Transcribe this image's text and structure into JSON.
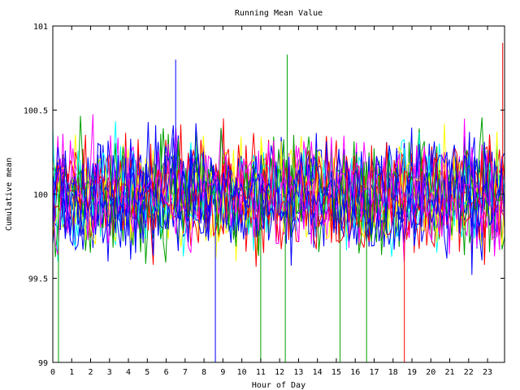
{
  "chart_data": {
    "type": "line",
    "title": "Running Mean Value",
    "xlabel": "Hour of Day",
    "ylabel": "Cumulative mean",
    "xlim": [
      0,
      23.9
    ],
    "ylim": [
      99,
      101
    ],
    "x_ticks": [
      "0",
      "1",
      "2",
      "3",
      "4",
      "5",
      "6",
      "7",
      "8",
      "9",
      "10",
      "11",
      "12",
      "13",
      "14",
      "15",
      "16",
      "17",
      "18",
      "19",
      "20",
      "21",
      "22",
      "23"
    ],
    "y_ticks": [
      {
        "value": 99,
        "label": "99"
      },
      {
        "value": 99.5,
        "label": "99.5"
      },
      {
        "value": 100,
        "label": "100"
      },
      {
        "value": 100.5,
        "label": "100.5"
      },
      {
        "value": 101,
        "label": "101"
      }
    ],
    "grid": false,
    "legend": "none",
    "series_colors": [
      "#ff0000",
      "#00a000",
      "#0000ff",
      "#ff00ff",
      "#00ffff",
      "#ffff00",
      "#0000ff",
      "#ff0000",
      "#00a000",
      "#0000ff",
      "#ff00ff",
      "#ff0000",
      "#0000ff",
      "#00ffff",
      "#ffff00",
      "#ff0000",
      "#0000ff",
      "#00a000",
      "#ff00ff",
      "#0000ff"
    ],
    "series_center": 100,
    "series_spread": 0.25,
    "spikes": [
      {
        "x": 0.3,
        "y": 99.0,
        "color": "#00a000"
      },
      {
        "x": 8.6,
        "y": 99.0,
        "color": "#0000ff"
      },
      {
        "x": 11.0,
        "y": 99.0,
        "color": "#00a000"
      },
      {
        "x": 12.3,
        "y": 99.0,
        "color": "#00a000"
      },
      {
        "x": 15.2,
        "y": 99.0,
        "color": "#00a000"
      },
      {
        "x": 16.6,
        "y": 99.0,
        "color": "#00a000"
      },
      {
        "x": 18.6,
        "y": 99.0,
        "color": "#ff0000"
      },
      {
        "x": 12.4,
        "y": 100.83,
        "color": "#00a000"
      },
      {
        "x": 6.5,
        "y": 100.8,
        "color": "#0000ff"
      },
      {
        "x": 23.8,
        "y": 100.9,
        "color": "#ff0000"
      }
    ]
  }
}
